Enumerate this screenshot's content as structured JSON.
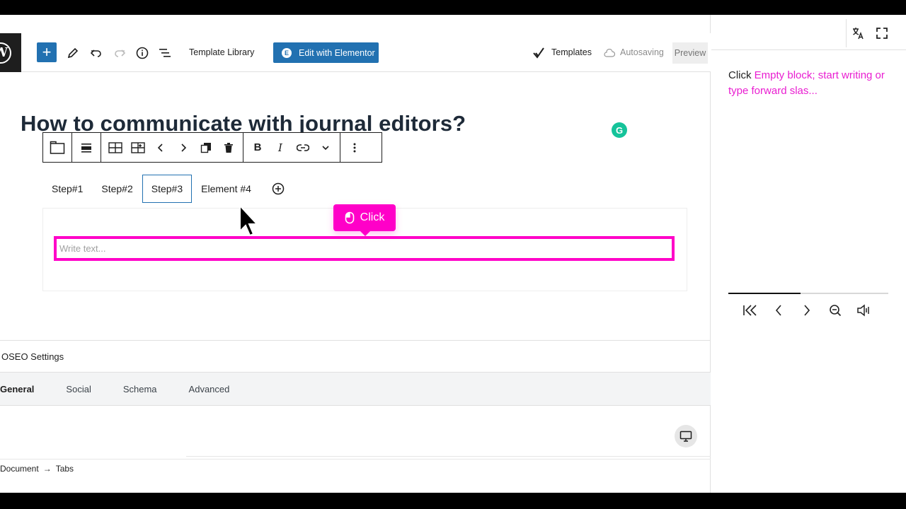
{
  "toolbar": {
    "template_library": "Template Library",
    "edit_elementor": "Edit with Elementor",
    "templates": "Templates",
    "autosaving": "Autosaving",
    "preview": "Preview"
  },
  "post": {
    "title": "How to communicate with journal editors?"
  },
  "tabs_block": {
    "tabs": [
      "Step#1",
      "Step#2",
      "Step#3",
      "Element #4"
    ],
    "active_index": 2,
    "placeholder": "Write text..."
  },
  "tooltip": {
    "label": "Click"
  },
  "seo": {
    "header": "OSEO Settings",
    "tabs": [
      "General",
      "Social",
      "Schema",
      "Advanced"
    ]
  },
  "breadcrumbs": {
    "root": "Document",
    "arrow": "→",
    "current": "Tabs"
  },
  "guide": {
    "step_prefix": "Click",
    "step_target": "Empty block; start writing or type forward slas...",
    "progress": 0.45
  },
  "colors": {
    "accent": "#2271b1",
    "highlight": "#ff00c8",
    "grammarly": "#15c39a"
  }
}
